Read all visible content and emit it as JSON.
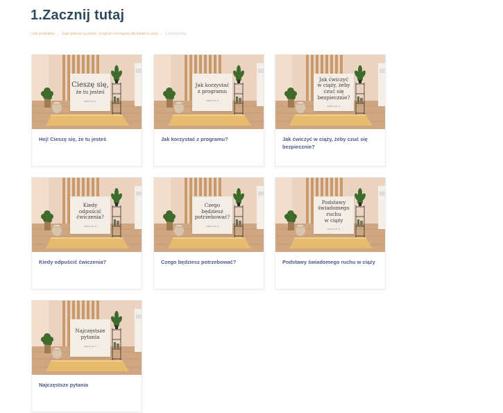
{
  "page": {
    "title": "1.Zacznij tutaj"
  },
  "breadcrumb": {
    "items": [
      "Lista produktów",
      "Ciało gotowe na poród - program treningowy dla kobiet w ciąży",
      "1.Zacznij tutaj"
    ]
  },
  "lessons": [
    {
      "title": "Hej! Cieszę się, że tu jesteś",
      "sign_line1": "Cieszę się,",
      "sign_line2": "że tu jesteś",
      "sign_lesson": "LEKCJA 1"
    },
    {
      "title": "Jak korzystać z programu?",
      "sign_line1": "Jak korzystać",
      "sign_line2": "z programu",
      "sign_lesson": "LEKCJA 2"
    },
    {
      "title": "Jak ćwiczyć w ciąży, żeby czuć się bezpiecznie?",
      "sign_line1": "Jak ćwiczyć",
      "sign_line2": "w ciąży, żeby",
      "sign_line3": "czuć się bezpiecznie?",
      "sign_lesson": "LEKCJA 3"
    },
    {
      "title": "Kiedy odpuścić ćwiczenia?",
      "sign_line1": "Kiedy odpuścić",
      "sign_line2": "ćwiczenia?",
      "sign_lesson": "LEKCJA 4"
    },
    {
      "title": "Czego będziesz potrzebować?",
      "sign_line1": "Czego będziesz",
      "sign_line2": "potrzebować?",
      "sign_lesson": "LEKCJA 5"
    },
    {
      "title": "Podstawy świadomego ruchu w ciąży",
      "sign_line1": "Podstawy",
      "sign_line2": "świadomego ruchu",
      "sign_line3": "w ciąży",
      "sign_lesson": "LEKCJA 6"
    },
    {
      "title": "Najczęstsze pytania",
      "sign_line1": "Najczęstsze",
      "sign_line2": "pytania",
      "sign_lesson": "LEKCJA 7"
    }
  ],
  "colors": {
    "title": "#2e4a5a",
    "breadcrumb_link": "#d4b56f",
    "card_title": "#4b5b8a"
  }
}
